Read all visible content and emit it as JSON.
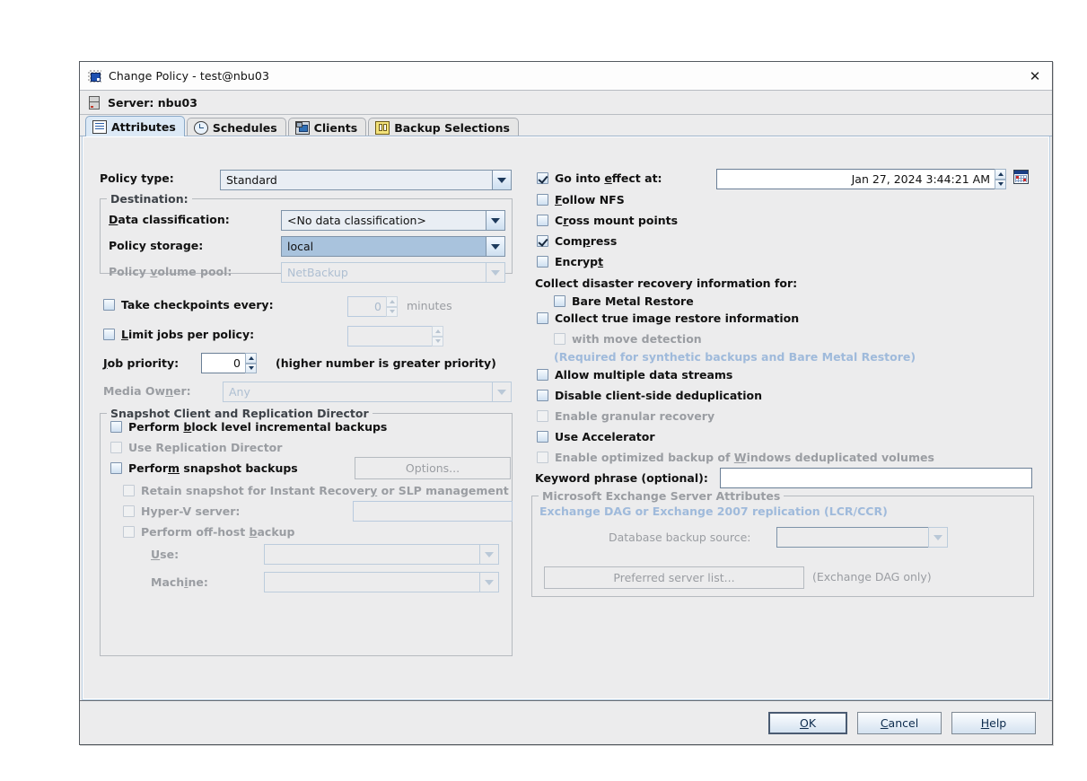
{
  "window": {
    "title": "Change Policy - test@nbu03",
    "close_label": "✕",
    "server_label": "Server: nbu03"
  },
  "tabs": [
    {
      "label": "Attributes",
      "icon": "attributes-icon",
      "active": true
    },
    {
      "label": "Schedules",
      "icon": "schedules-icon",
      "active": false
    },
    {
      "label": "Clients",
      "icon": "clients-icon",
      "active": false
    },
    {
      "label": "Backup Selections",
      "icon": "backup-selections-icon",
      "active": false
    }
  ],
  "left": {
    "policy_type_label": "Policy type:",
    "policy_type_value": "Standard",
    "destination_caption": "Destination:",
    "data_classification_label": "Data classification:",
    "data_classification_value": "<No data classification>",
    "policy_storage_label": "Policy storage:",
    "policy_storage_value": "local",
    "policy_volume_pool_label": "Policy volume pool:",
    "policy_volume_pool_value": "NetBackup",
    "take_checkpoints_label": "Take checkpoints every:",
    "take_checkpoints_value": "0",
    "minutes_label": "minutes",
    "limit_jobs_label": "Limit jobs per policy:",
    "limit_jobs_value": "",
    "job_priority_label": "Job priority:",
    "job_priority_value": "0",
    "job_priority_hint": "(higher number is greater priority)",
    "media_owner_label": "Media Owner:",
    "media_owner_value": "Any",
    "snapshot_caption": "Snapshot Client and Replication Director",
    "block_level_label": "Perform block level incremental backups",
    "replication_director_label": "Use Replication Director",
    "snapshot_backups_label": "Perform snapshot backups",
    "options_button": "Options...",
    "retain_snapshot_label": "Retain snapshot for Instant Recovery or SLP management",
    "hyperv_label": "Hyper-V server:",
    "hyperv_value": "",
    "offhost_label": "Perform off-host backup",
    "use_label": "Use:",
    "use_value": "",
    "machine_label": "Machine:",
    "machine_value": ""
  },
  "right": {
    "go_into_effect_label": "Go into effect at:",
    "go_into_effect_value": "Jan 27, 2024 3:44:21 AM",
    "follow_nfs_label": "Follow NFS",
    "cross_mount_label": "Cross mount points",
    "compress_label": "Compress",
    "encrypt_label": "Encrypt",
    "collect_dr_label": "Collect disaster recovery information for:",
    "bare_metal_label": "Bare Metal Restore",
    "true_image_label": "Collect true image restore information",
    "move_detection_label": "with move detection",
    "required_note": "(Required for synthetic backups and Bare Metal Restore)",
    "multiple_streams_label": "Allow multiple data streams",
    "disable_dedup_label": "Disable client-side deduplication",
    "granular_recovery_label": "Enable granular recovery",
    "accelerator_label": "Use Accelerator",
    "optimized_backup_label": "Enable optimized backup of Windows deduplicated volumes",
    "keyword_label": "Keyword phrase (optional):",
    "keyword_value": "",
    "exchange_caption": "Microsoft Exchange Server Attributes",
    "exchange_note": "Exchange DAG or Exchange 2007 replication (LCR/CCR)",
    "db_source_label": "Database backup source:",
    "db_source_value": "",
    "preferred_server_button": "Preferred server list...",
    "exchange_dag_note": "(Exchange DAG only)"
  },
  "buttons": {
    "ok": "OK",
    "cancel": "Cancel",
    "help": "Help"
  },
  "colors": {
    "selection_blue": "#a9c3dd",
    "tab_active": "#dce9f6",
    "panel_bg": "#ececed",
    "disabled_text": "#9a9da2"
  }
}
